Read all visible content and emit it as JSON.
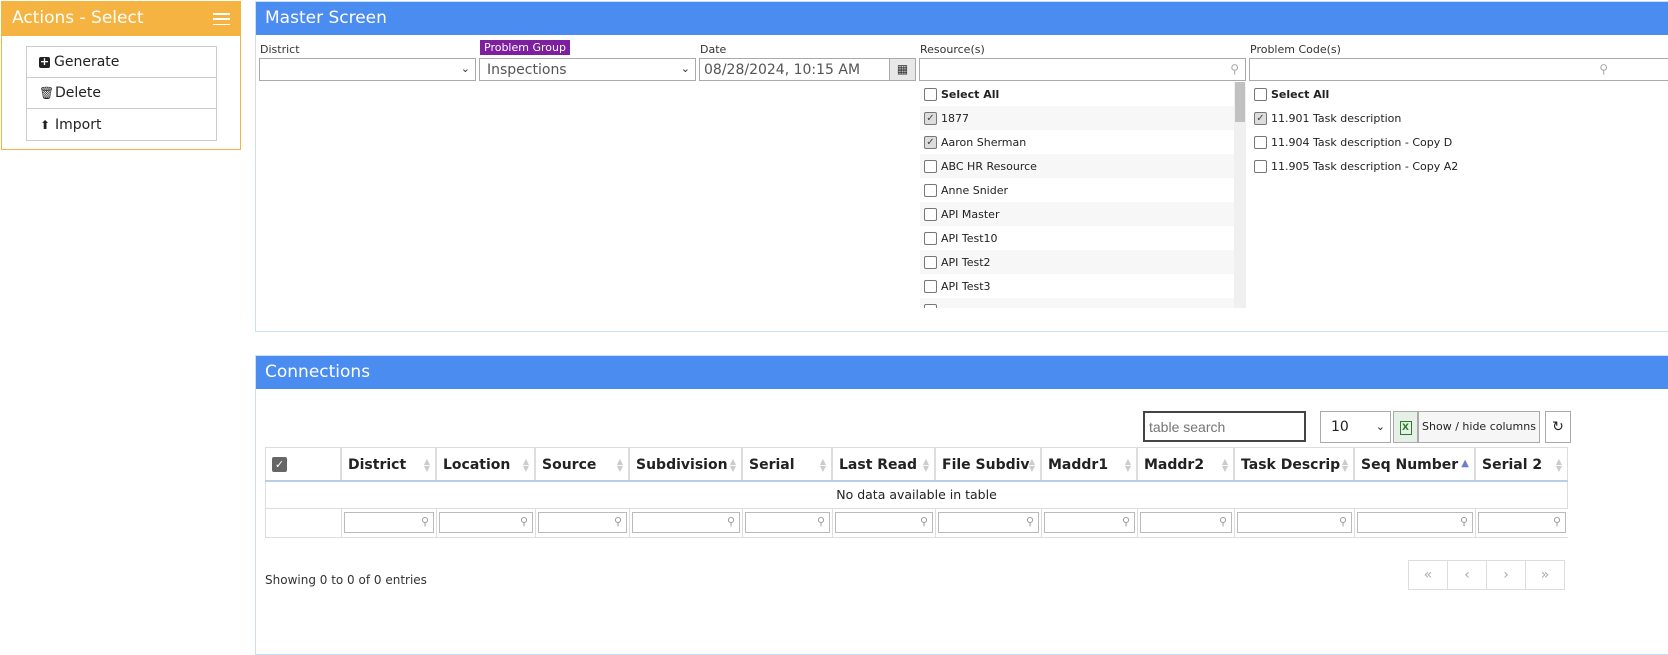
{
  "actions": {
    "title": "Actions - Select",
    "items": [
      {
        "label": "Generate",
        "icon": "plus-square-icon"
      },
      {
        "label": "Delete",
        "icon": "trash-icon"
      },
      {
        "label": "Import",
        "icon": "upload-icon"
      }
    ]
  },
  "master": {
    "title": "Master Screen",
    "district": {
      "label": "District",
      "value": ""
    },
    "problem_group": {
      "label": "Problem Group",
      "value": "Inspections"
    },
    "date": {
      "label": "Date",
      "value": "08/28/2024, 10:15 AM"
    },
    "resources": {
      "label": "Resource(s)",
      "select_all": "Select All",
      "items": [
        {
          "label": "1877",
          "checked": true
        },
        {
          "label": "Aaron Sherman",
          "checked": true
        },
        {
          "label": "ABC HR Resource",
          "checked": false
        },
        {
          "label": "Anne Snider",
          "checked": false
        },
        {
          "label": "API Master",
          "checked": false
        },
        {
          "label": "API Test10",
          "checked": false
        },
        {
          "label": "API Test2",
          "checked": false
        },
        {
          "label": "API Test3",
          "checked": false
        }
      ]
    },
    "problem_codes": {
      "label": "Problem Code(s)",
      "select_all": "Select All",
      "items": [
        {
          "label": "11.901 Task description",
          "checked": true
        },
        {
          "label": "11.904 Task description - Copy D",
          "checked": false
        },
        {
          "label": "11.905 Task description - Copy A2",
          "checked": false
        }
      ]
    }
  },
  "connections": {
    "title": "Connections",
    "search_placeholder": "table search",
    "page_length": "10",
    "show_hide_label": "Show / hide columns",
    "columns": [
      "District",
      "Location",
      "Source",
      "Subdivision",
      "Serial",
      "Last Read",
      "File Subdiv",
      "Maddr1",
      "Maddr2",
      "Task Descrip",
      "Seq Number",
      "Serial 2"
    ],
    "empty_message": "No data available in table",
    "info": "Showing 0 to 0 of 0 entries",
    "pager": [
      "«",
      "‹",
      "›",
      "»"
    ]
  },
  "colors": {
    "actions_accent": "#f5b342",
    "panel_header": "#4a8cf0",
    "problem_group_badge": "#7d1f9e"
  }
}
